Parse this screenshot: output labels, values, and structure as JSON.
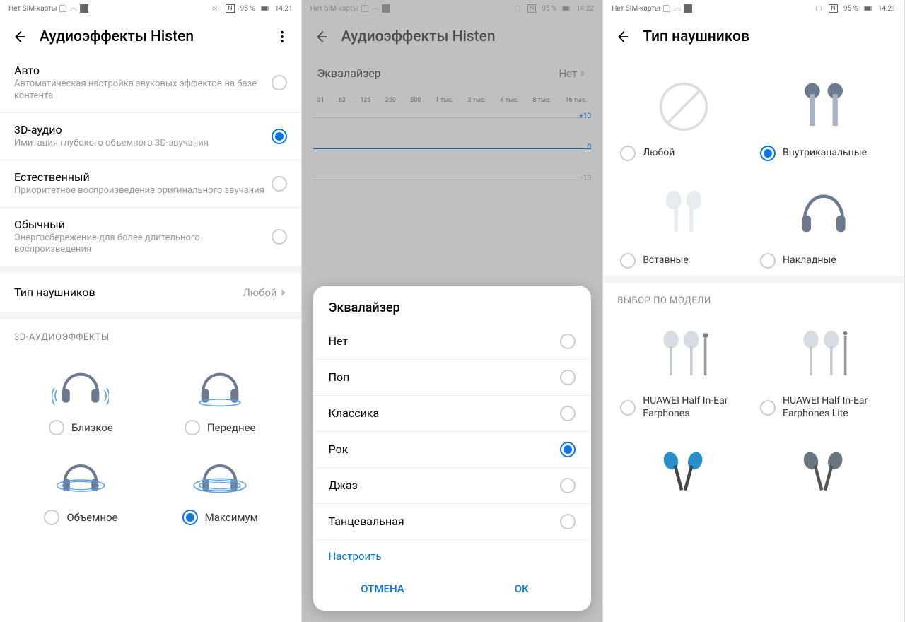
{
  "status": {
    "sim": "Нет SIM-карты",
    "nfc": "95 %",
    "time1": "14:21",
    "time2": "14:22",
    "time3": "14:21",
    "nfc_label": "N"
  },
  "screen1": {
    "title": "Аудиоэффекты Histen",
    "modes": [
      {
        "title": "Авто",
        "sub": "Автоматическая настройка звуковых эффектов на базе контента",
        "checked": false
      },
      {
        "title": "3D-аудио",
        "sub": "Имитация глубокого объемного 3D-звучания",
        "checked": true
      },
      {
        "title": "Естественный",
        "sub": "Приоритетное воспроизведение оригинального звучания",
        "checked": false
      },
      {
        "title": "Обычный",
        "sub": "Энергосбережение для более длительного воспроизведения",
        "checked": false
      }
    ],
    "headphone_type": {
      "label": "Тип наушников",
      "value": "Любой"
    },
    "fx_section": "3D-АУДИОЭФФЕКТЫ",
    "fx": [
      {
        "label": "Близкое",
        "checked": false
      },
      {
        "label": "Переднее",
        "checked": false
      },
      {
        "label": "Объемное",
        "checked": false
      },
      {
        "label": "Максимум",
        "checked": true
      }
    ]
  },
  "screen2": {
    "title": "Аудиоэффекты Histen",
    "eq_label": "Эквалайзер",
    "eq_value": "Нет",
    "bands": [
      "31",
      "62",
      "125",
      "250",
      "500",
      "1 тыс.",
      "2 тыс.",
      "4 тыс.",
      "8 тыс.",
      "16 тыс."
    ],
    "scale": {
      "plus": "+10",
      "zero": "0",
      "minus": "-10"
    },
    "dialog": {
      "title": "Эквалайзер",
      "options": [
        {
          "label": "Нет",
          "checked": false
        },
        {
          "label": "Поп",
          "checked": false
        },
        {
          "label": "Классика",
          "checked": false
        },
        {
          "label": "Рок",
          "checked": true
        },
        {
          "label": "Джаз",
          "checked": false
        },
        {
          "label": "Танцевальная",
          "checked": false
        }
      ],
      "customize": "Настроить",
      "cancel": "ОТМЕНА",
      "ok": "ОК"
    }
  },
  "screen3": {
    "title": "Тип наушников",
    "types": [
      {
        "label": "Любой",
        "checked": false
      },
      {
        "label": "Внутриканальные",
        "checked": true
      },
      {
        "label": "Вставные",
        "checked": false
      },
      {
        "label": "Накладные",
        "checked": false
      }
    ],
    "model_section": "ВЫБОР ПО МОДЕЛИ",
    "models": [
      {
        "label": "HUAWEI Half In-Ear Earphones",
        "checked": false
      },
      {
        "label": "HUAWEI Half In-Ear Earphones Lite",
        "checked": false
      }
    ]
  }
}
